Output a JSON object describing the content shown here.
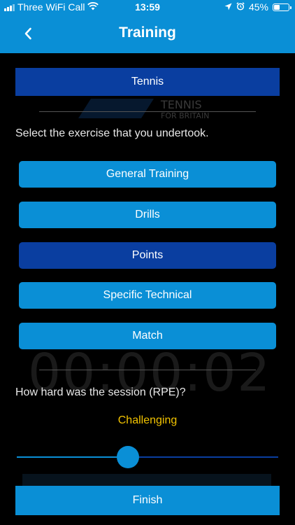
{
  "status_bar": {
    "carrier": "Three WiFi Call",
    "time": "13:59",
    "battery_percent": "45%",
    "battery_level": 0.45,
    "icons": [
      "signal-icon",
      "wifi-icon",
      "location-icon",
      "alarm-icon",
      "battery-icon"
    ]
  },
  "nav": {
    "back_icon": "chevron-left-icon",
    "title": "Training"
  },
  "sport": {
    "label": "Tennis"
  },
  "watermark": {
    "line1": "TENNIS",
    "line2": "FOR BRITAIN"
  },
  "exercise": {
    "prompt": "Select the exercise that you undertook.",
    "options": [
      {
        "label": "General Training",
        "selected": false
      },
      {
        "label": "Drills",
        "selected": false
      },
      {
        "label": "Points",
        "selected": true
      },
      {
        "label": "Specific Technical",
        "selected": false
      },
      {
        "label": "Match",
        "selected": false
      }
    ]
  },
  "timer_ghost": "00:00:02",
  "rpe": {
    "prompt": "How hard was the session (RPE)?",
    "value_label": "Challenging",
    "slider_fraction": 0.425
  },
  "finish": {
    "label": "Finish"
  },
  "colors": {
    "primary": "#0a8fd6",
    "selected": "#0a3ea0",
    "accent": "#f2c300",
    "background": "#000000"
  }
}
